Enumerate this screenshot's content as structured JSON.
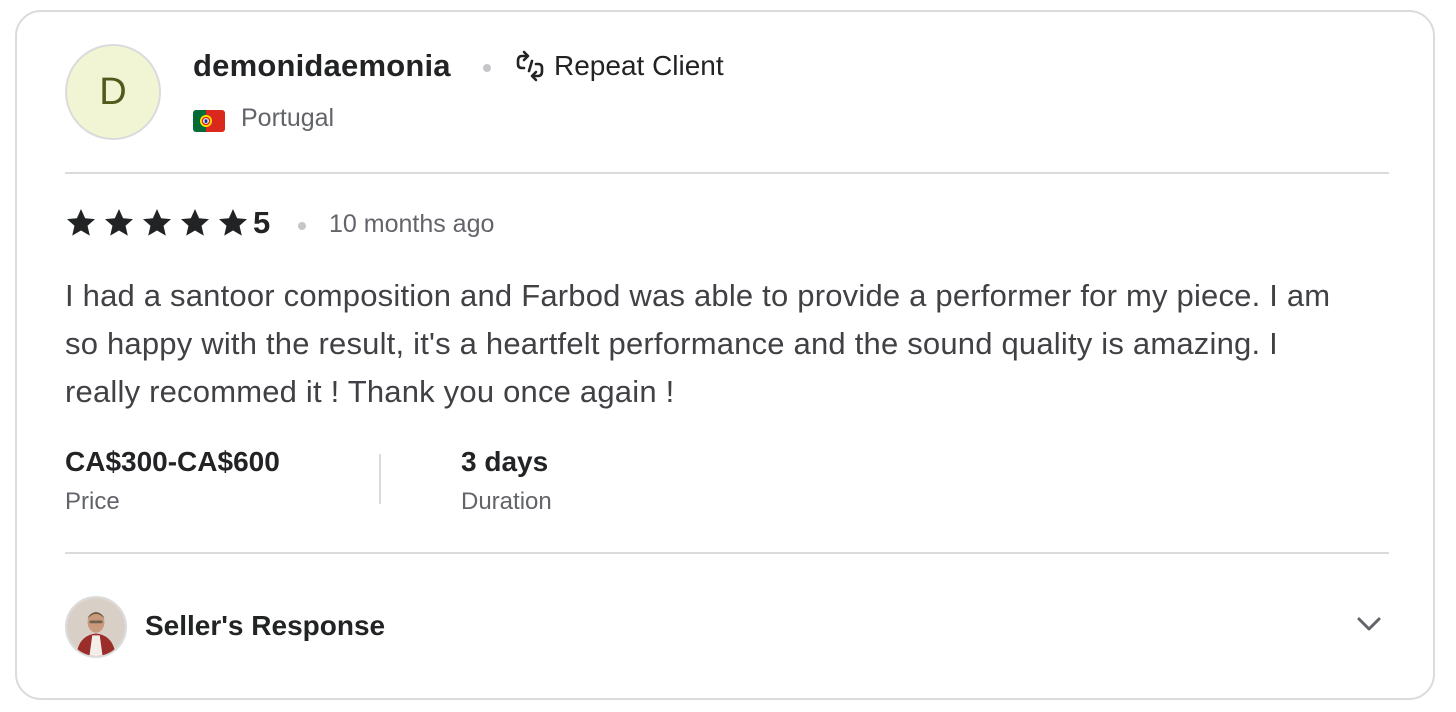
{
  "reviewer": {
    "avatar_initial": "D",
    "username": "demonidaemonia",
    "badge": "Repeat Client",
    "country": "Portugal",
    "flag_icon": "portugal-flag-icon"
  },
  "rating": {
    "stars": 5,
    "value": "5",
    "time_ago": "10 months ago"
  },
  "review_text": "I had a santoor composition and Farbod was able to provide a performer for my piece. I am so happy with the result, it's a heartfelt performance and the sound quality is amazing. I really recommed it ! Thank you once again !",
  "stats": {
    "price": {
      "value": "CA$300-CA$600",
      "label": "Price"
    },
    "duration": {
      "value": "3 days",
      "label": "Duration"
    }
  },
  "seller_response": {
    "title": "Seller's Response",
    "expand_icon": "chevron-down-icon"
  },
  "colors": {
    "avatar_bg": "#f1f5d3",
    "avatar_text": "#4f5a1c",
    "text_primary": "#222325",
    "text_secondary": "#62646a",
    "border": "#dadbdd"
  }
}
